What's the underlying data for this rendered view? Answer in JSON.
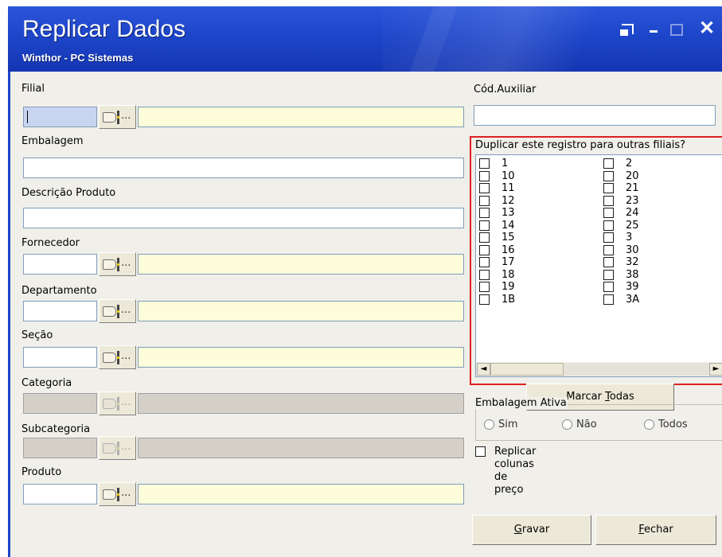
{
  "window": {
    "title": "Replicar Dados",
    "subtitle": "Winthor - PC Sistemas"
  },
  "form": {
    "filial_label": "Filial",
    "embalagem_label": "Embalagem",
    "descricao_label": "Descrição Produto",
    "fornecedor_label": "Fornecedor",
    "departamento_label": "Departamento",
    "secao_label": "Seção",
    "categoria_label": "Categoria",
    "subcategoria_label": "Subcategoria",
    "produto_label": "Produto",
    "cod_auxiliar_label": "Cód.Auxiliar",
    "lookup_dots": "..."
  },
  "duplicar": {
    "title": "Duplicar este registro para outras filiais?",
    "col1": [
      "1",
      "10",
      "11",
      "12",
      "13",
      "14",
      "15",
      "16",
      "17",
      "18",
      "19",
      "1B"
    ],
    "col2": [
      "2",
      "20",
      "21",
      "23",
      "24",
      "25",
      "3",
      "30",
      "32",
      "38",
      "39",
      "3A"
    ],
    "scroll_left": "◄",
    "scroll_right": "►"
  },
  "buttons": {
    "marcar_pre": "Marcar ",
    "marcar_key": "T",
    "marcar_post": "odas",
    "gravar_key": "G",
    "gravar_post": "ravar",
    "fechar_key": "F",
    "fechar_post": "echar"
  },
  "embalagem_ativa": {
    "title": "Embalagem Ativa",
    "options": [
      "Sim",
      "Não",
      "Todos"
    ]
  },
  "replicar_precos_label": "Replicar colunas de preço",
  "window_controls": {
    "close": "✕"
  }
}
